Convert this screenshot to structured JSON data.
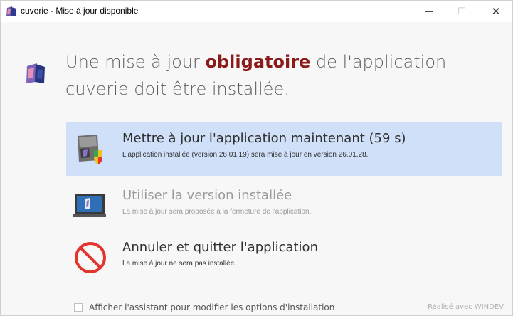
{
  "window": {
    "title": "cuverie - Mise à jour disponible",
    "minimize": "—",
    "maximize": "☐",
    "close": "✕"
  },
  "header": {
    "line1_before": "Une mise à jour ",
    "line1_strong": "obligatoire",
    "line1_after": " de l'application",
    "line2": "cuverie doit être installée."
  },
  "options": [
    {
      "title": "Mettre à jour l'application maintenant (59 s)",
      "description": "L'application installée (version 26.01.19) sera mise à jour en version 26.01.28.",
      "icon": "update-box-shield-icon",
      "state": "highlighted"
    },
    {
      "title": "Utiliser la version installée",
      "description": "La mise à jour sera proposée à la fermeture de l'application.",
      "icon": "computer-monitor-icon",
      "state": "disabled"
    },
    {
      "title": "Annuler et quitter l'application",
      "description": "La mise à jour ne sera pas installée.",
      "icon": "prohibited-sign-icon",
      "state": "normal"
    }
  ],
  "footer": {
    "checkbox_label": "Afficher l'assistant pour modifier les options d'installation",
    "checkbox_checked": false,
    "brand": "Réalisé avec WINDEV"
  },
  "colors": {
    "accent_strong": "#8b1a1a",
    "highlight": "#cfe0f8",
    "prohibited": "#e0342c"
  }
}
